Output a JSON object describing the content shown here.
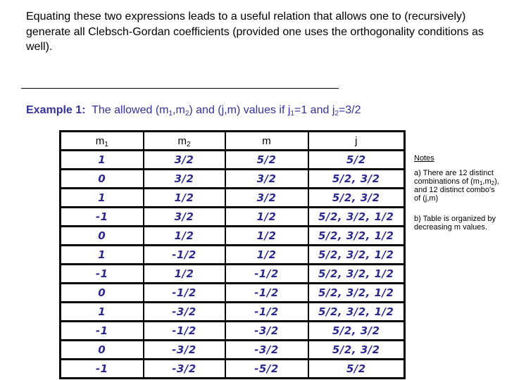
{
  "intro": {
    "text": "Equating these two expressions leads to a useful relation that allows one to (recursively) generate all Clebsch-Gordan coefficients (provided one uses the orthogonality conditions as well)."
  },
  "example": {
    "label": "Example 1:",
    "text_before": "The allowed (m",
    "sub1": "1",
    "text_mid1": ",m",
    "sub2": "2",
    "text_mid2": ") and (j,m) values if j",
    "sub3": "1",
    "text_mid3": "=1 and j",
    "sub4": "2",
    "text_after": "=3/2"
  },
  "table": {
    "headers": [
      {
        "base": "m",
        "sub": "1"
      },
      {
        "base": "m",
        "sub": "2"
      },
      {
        "base": "m",
        "sub": ""
      },
      {
        "base": "j",
        "sub": ""
      }
    ],
    "rows": [
      {
        "m1": "1",
        "m2": "3/2",
        "m": "5/2",
        "j": "5/2"
      },
      {
        "m1": "0",
        "m2": "3/2",
        "m": "3/2",
        "j": "5/2, 3/2"
      },
      {
        "m1": "1",
        "m2": "1/2",
        "m": "3/2",
        "j": "5/2, 3/2"
      },
      {
        "m1": "-1",
        "m2": "3/2",
        "m": "1/2",
        "j": "5/2, 3/2, 1/2"
      },
      {
        "m1": "0",
        "m2": "1/2",
        "m": "1/2",
        "j": "5/2, 3/2, 1/2"
      },
      {
        "m1": "1",
        "m2": "-1/2",
        "m": "1/2",
        "j": "5/2, 3/2, 1/2"
      },
      {
        "m1": "-1",
        "m2": "1/2",
        "m": "-1/2",
        "j": "5/2, 3/2, 1/2"
      },
      {
        "m1": "0",
        "m2": "-1/2",
        "m": "-1/2",
        "j": "5/2, 3/2, 1/2"
      },
      {
        "m1": "1",
        "m2": "-3/2",
        "m": "-1/2",
        "j": "5/2, 3/2, 1/2"
      },
      {
        "m1": "-1",
        "m2": "-1/2",
        "m": "-3/2",
        "j": "5/2, 3/2"
      },
      {
        "m1": "0",
        "m2": "-3/2",
        "m": "-3/2",
        "j": "5/2, 3/2"
      },
      {
        "m1": "-1",
        "m2": "-3/2",
        "m": "-5/2",
        "j": "5/2"
      }
    ]
  },
  "notes": {
    "title": "Notes",
    "a_before": "a) There are 12 distinct combinations of (m",
    "a_sub1": "1",
    "a_mid": ",m",
    "a_sub2": "2",
    "a_after": "), and 12 distinct combo's of (j,m)",
    "b": "b) Table is organized by decreasing m values."
  },
  "colors": {
    "heading": "#333399",
    "handwriting": "#2b2b8c"
  }
}
